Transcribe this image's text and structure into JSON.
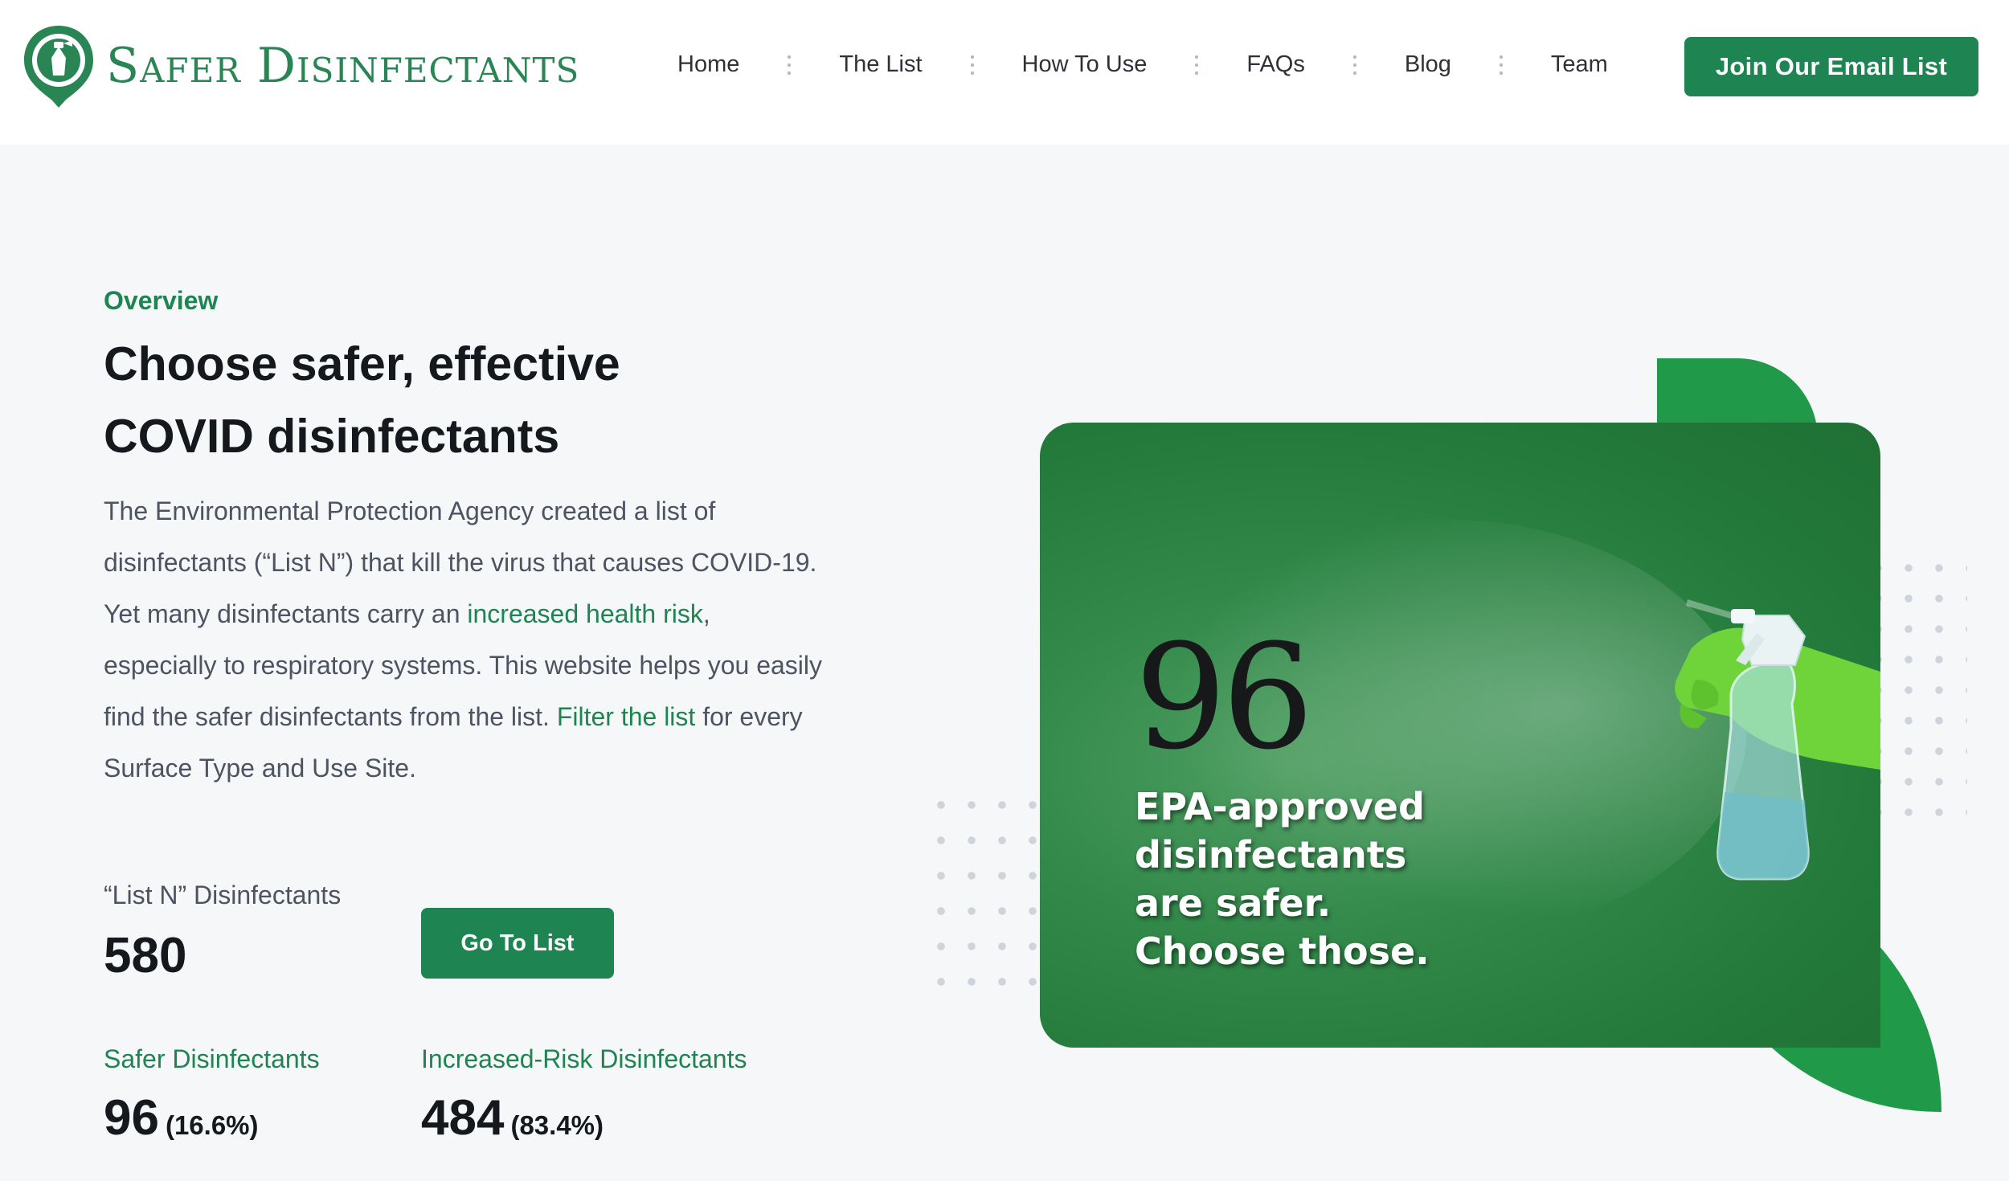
{
  "brand": {
    "name": "Safer Disinfectants"
  },
  "nav": {
    "items": [
      {
        "label": "Home"
      },
      {
        "label": "The List"
      },
      {
        "label": "How To Use"
      },
      {
        "label": "FAQs"
      },
      {
        "label": "Blog"
      },
      {
        "label": "Team"
      }
    ],
    "cta_label": "Join Our Email List"
  },
  "hero": {
    "eyebrow": "Overview",
    "title_line1": "Choose safer, effective",
    "title_line2": "COVID disinfectants",
    "body_part1": "The Environmental Protection Agency created a list of disinfectants (“List N”) that kill the virus that causes COVID-19. Yet many disinfectants carry an ",
    "body_link1": "increased health risk",
    "body_part2": ", especially to respiratory systems. This website helps you easily find the safer disinfectants from the list. ",
    "body_link2": "Filter the list",
    "body_part3": " for every Surface Type and Use Site."
  },
  "stats": {
    "list_n_label": "“List N” Disinfectants",
    "list_n_value": "580",
    "go_button_label": "Go To List",
    "safer_label": "Safer Disinfectants",
    "safer_value": "96",
    "safer_pct": "(16.6%)",
    "risk_label": "Increased-Risk Disinfectants",
    "risk_value": "484",
    "risk_pct": "(83.4%)"
  },
  "feature_image": {
    "number": "96",
    "caption": "EPA-approved disinfectants are safer. Choose those."
  },
  "icons": [
    "safer-disinfectants-logo-icon",
    "spray-bottle-illustration"
  ],
  "colors": {
    "brand_green": "#1e8452",
    "accent_green": "#209a48",
    "glove_green": "#6fd43a"
  }
}
